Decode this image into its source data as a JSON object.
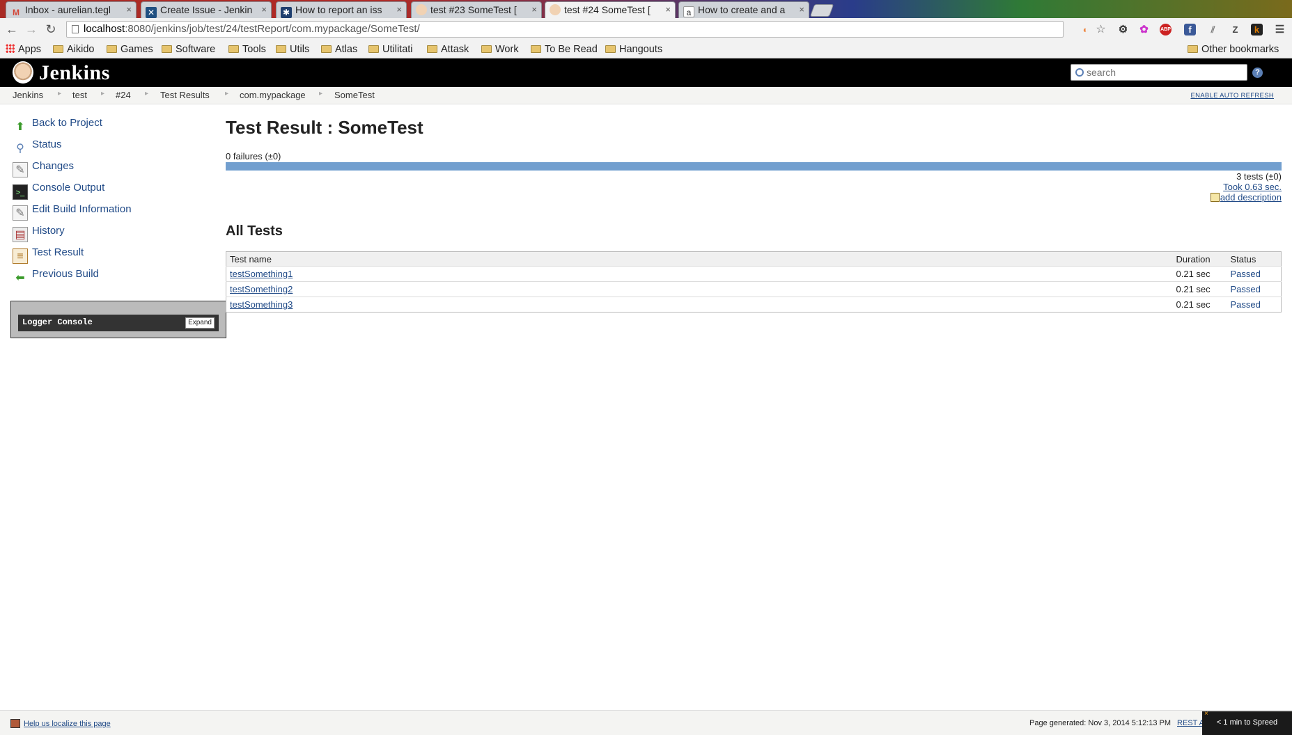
{
  "browser": {
    "tabs": [
      {
        "title": "Inbox - aurelian.tegl",
        "icon": "gmail-icon",
        "color": "#d44638"
      },
      {
        "title": "Create Issue - Jenkin",
        "icon": "jira-icon",
        "color": "#205081"
      },
      {
        "title": "How to report an iss",
        "icon": "confluence-icon",
        "color": "#1f3f6f"
      },
      {
        "title": "test #23 SomeTest [",
        "icon": "jenkins-icon",
        "color": "#c9a27e"
      },
      {
        "title": "test #24 SomeTest [",
        "icon": "jenkins-icon",
        "color": "#c9a27e"
      },
      {
        "title": "How to create and a",
        "icon": "amazon-icon",
        "color": "#ffffff"
      }
    ],
    "active_tab": 4,
    "url_host": "localhost",
    "url_path": ":8080/jenkins/job/test/24/testReport/com.mypackage/SomeTest/",
    "extensions": [
      {
        "glyph": "◐",
        "name": "color-picker-icon",
        "color": "#e84"
      },
      {
        "glyph": "☆",
        "name": "bookmark-star-icon",
        "color": "#666"
      },
      {
        "glyph": "⚙",
        "name": "settings-gear-icon",
        "color": "#333"
      },
      {
        "glyph": "✿",
        "name": "colorful-extension-icon",
        "color": "#c3c"
      },
      {
        "glyph": "ABP",
        "name": "adblock-icon",
        "color": "#c22"
      },
      {
        "glyph": "f",
        "name": "facebook-icon",
        "color": "#3b5998"
      },
      {
        "glyph": "⫽",
        "name": "library-icon",
        "color": "#777"
      },
      {
        "glyph": "Z",
        "name": "zotero-icon",
        "color": "#444"
      },
      {
        "glyph": "k",
        "name": "k-extension-icon",
        "color": "#e07b00"
      },
      {
        "glyph": "☰",
        "name": "menu-icon",
        "color": "#444"
      }
    ],
    "bookmarks": {
      "apps": "Apps",
      "items": [
        "Aikido",
        "Games",
        "Software",
        "Tools",
        "Utils",
        "Atlas",
        "Utilitati",
        "Attask",
        "Work",
        "To Be Read",
        "Hangouts"
      ],
      "other": "Other bookmarks"
    }
  },
  "jenkins": {
    "title": "Jenkins",
    "search_placeholder": "search",
    "help": "?",
    "breadcrumbs": [
      "Jenkins",
      "test",
      "#24",
      "Test Results",
      "com.mypackage",
      "SomeTest"
    ],
    "auto_refresh": "ENABLE AUTO REFRESH",
    "sidebar": [
      {
        "label": "Back to Project",
        "icon": "up-arrow-icon",
        "glyph": "⬆",
        "color": "#3a9a2a"
      },
      {
        "label": "Status",
        "icon": "magnifier-icon",
        "glyph": "🔍",
        "color": "#5b7fb5"
      },
      {
        "label": "Changes",
        "icon": "notepad-icon",
        "glyph": "✎",
        "color": "#777"
      },
      {
        "label": "Console Output",
        "icon": "terminal-icon",
        "glyph": "▣",
        "color": "#222"
      },
      {
        "label": "Edit Build Information",
        "icon": "notepad-edit-icon",
        "glyph": "✎",
        "color": "#777"
      },
      {
        "label": "History",
        "icon": "history-icon",
        "glyph": "▤",
        "color": "#a33"
      },
      {
        "label": "Test Result",
        "icon": "clipboard-icon",
        "glyph": "📋",
        "color": "#b07a2a"
      },
      {
        "label": "Previous Build",
        "icon": "left-arrow-icon",
        "glyph": "⬅",
        "color": "#3a9a2a"
      }
    ],
    "logger": {
      "title": "Logger Console",
      "expand": "Expand"
    },
    "main": {
      "title": "Test Result : SomeTest",
      "failures": "0 failures (±0)",
      "tests_count": "3 tests (±0)",
      "took": "Took 0.63 sec.",
      "add_description": "add description",
      "all_tests_heading": "All Tests",
      "table": {
        "headers": [
          "Test name",
          "Duration",
          "Status"
        ],
        "rows": [
          {
            "name": "testSomething1",
            "duration": "0.21 sec",
            "status": "Passed"
          },
          {
            "name": "testSomething2",
            "duration": "0.21 sec",
            "status": "Passed"
          },
          {
            "name": "testSomething3",
            "duration": "0.21 sec",
            "status": "Passed"
          }
        ]
      }
    },
    "footer": {
      "localize": "Help us localize this page",
      "generated": "Page generated: Nov 3, 2014 5:12:13 PM",
      "rest": "REST A"
    },
    "spreed": {
      "text": "< 1 min to Spreed",
      "close": "×"
    }
  }
}
